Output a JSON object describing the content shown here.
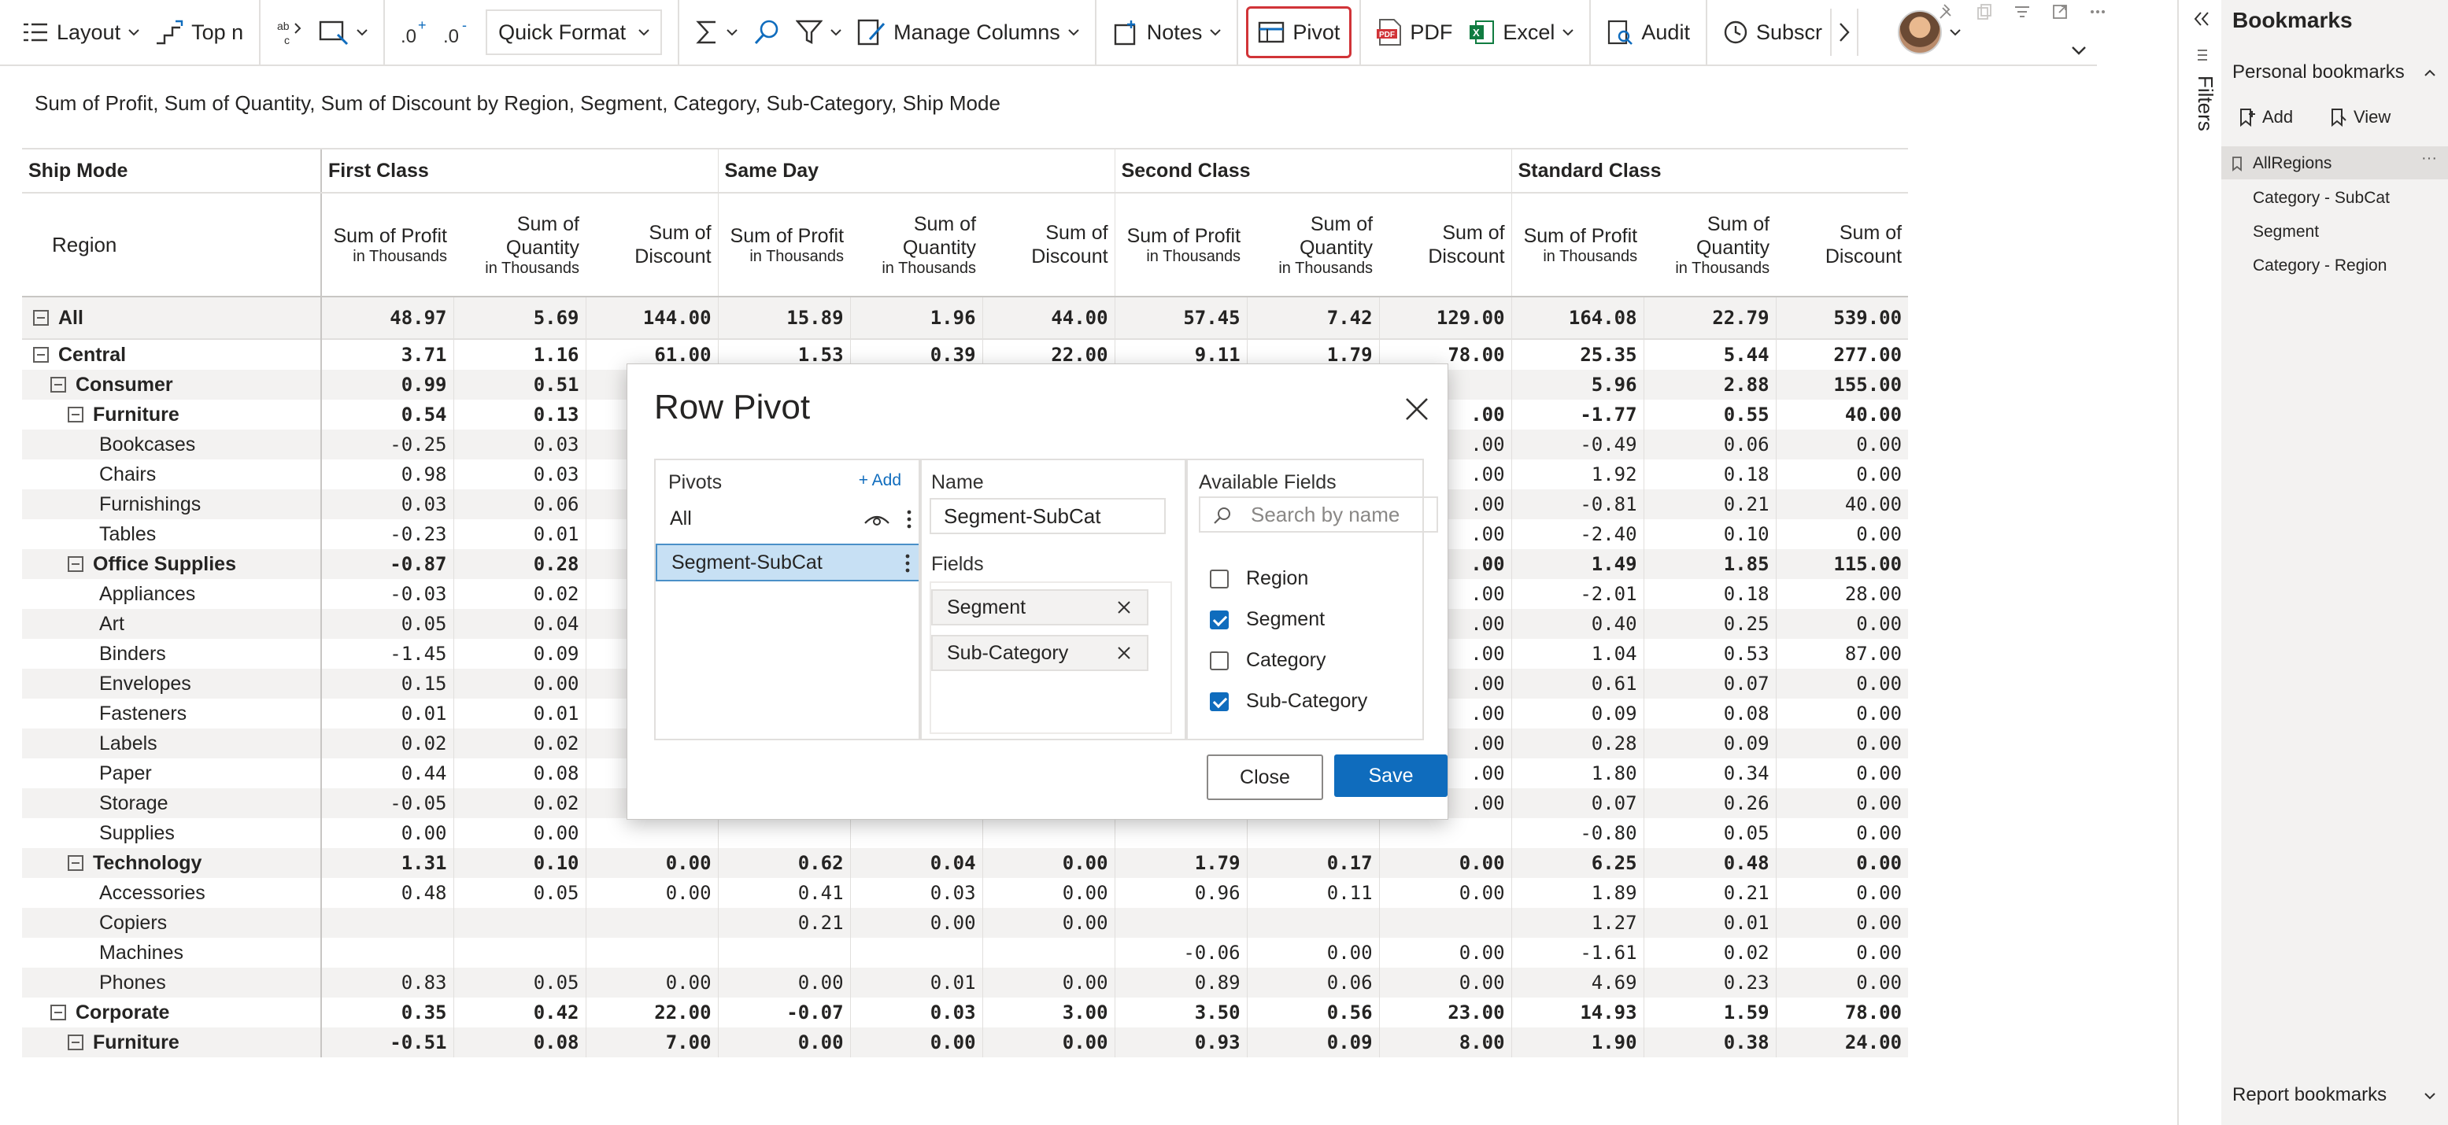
{
  "toolbar": {
    "layout": "Layout",
    "top_n": "Top n",
    "quick_format": "Quick Format",
    "manage_columns": "Manage Columns",
    "notes": "Notes",
    "pivot": "Pivot",
    "pdf": "PDF",
    "excel": "Excel",
    "audit": "Audit",
    "subscribe": "Subscr"
  },
  "report": {
    "title": "Sum of Profit, Sum of Quantity, Sum of Discount by Region, Segment, Category, Sub-Category, Ship Mode"
  },
  "table": {
    "col_group_label": "Ship Mode",
    "row_label": "Region",
    "ship_modes": [
      "First Class",
      "Same Day",
      "Second Class",
      "Standard Class"
    ],
    "measures": {
      "profit": "Sum of Profit",
      "quantity_1": "Sum of",
      "quantity_2": "Quantity",
      "discount_1": "Sum of",
      "discount_2": "Discount",
      "unit": "in Thousands"
    },
    "rows": [
      {
        "label": "All",
        "v": [
          "48.97",
          "5.69",
          "144.00",
          "15.89",
          "1.96",
          "44.00",
          "57.45",
          "7.42",
          "129.00",
          "164.08",
          "22.79",
          "539.00"
        ]
      },
      {
        "label": "Central",
        "v": [
          "3.71",
          "1.16",
          "61.00",
          "1.53",
          "0.39",
          "22.00",
          "9.11",
          "1.79",
          "78.00",
          "25.35",
          "5.44",
          "277.00"
        ]
      },
      {
        "label": "Consumer",
        "v": [
          "0.99",
          "0.51",
          "",
          "",
          "",
          "",
          "",
          "",
          "",
          "5.96",
          "2.88",
          "155.00"
        ]
      },
      {
        "label": "Furniture",
        "v": [
          "0.54",
          "0.13",
          "",
          "",
          "",
          "",
          "",
          "",
          ".00",
          "-1.77",
          "0.55",
          "40.00"
        ]
      },
      {
        "label": "Bookcases",
        "v": [
          "-0.25",
          "0.03",
          "",
          "",
          "",
          "",
          "",
          "",
          ".00",
          "-0.49",
          "0.06",
          "0.00"
        ]
      },
      {
        "label": "Chairs",
        "v": [
          "0.98",
          "0.03",
          "",
          "",
          "",
          "",
          "",
          "",
          ".00",
          "1.92",
          "0.18",
          "0.00"
        ]
      },
      {
        "label": "Furnishings",
        "v": [
          "0.03",
          "0.06",
          "",
          "",
          "",
          "",
          "",
          "",
          ".00",
          "-0.81",
          "0.21",
          "40.00"
        ]
      },
      {
        "label": "Tables",
        "v": [
          "-0.23",
          "0.01",
          "",
          "",
          "",
          "",
          "",
          "",
          ".00",
          "-2.40",
          "0.10",
          "0.00"
        ]
      },
      {
        "label": "Office Supplies",
        "v": [
          "-0.87",
          "0.28",
          "",
          "",
          "",
          "",
          "",
          "",
          ".00",
          "1.49",
          "1.85",
          "115.00"
        ]
      },
      {
        "label": "Appliances",
        "v": [
          "-0.03",
          "0.02",
          "",
          "",
          "",
          "",
          "",
          "",
          ".00",
          "-2.01",
          "0.18",
          "28.00"
        ]
      },
      {
        "label": "Art",
        "v": [
          "0.05",
          "0.04",
          "",
          "",
          "",
          "",
          "",
          "",
          ".00",
          "0.40",
          "0.25",
          "0.00"
        ]
      },
      {
        "label": "Binders",
        "v": [
          "-1.45",
          "0.09",
          "",
          "",
          "",
          "",
          "",
          "",
          ".00",
          "1.04",
          "0.53",
          "87.00"
        ]
      },
      {
        "label": "Envelopes",
        "v": [
          "0.15",
          "0.00",
          "",
          "",
          "",
          "",
          "",
          "",
          ".00",
          "0.61",
          "0.07",
          "0.00"
        ]
      },
      {
        "label": "Fasteners",
        "v": [
          "0.01",
          "0.01",
          "",
          "",
          "",
          "",
          "",
          "",
          ".00",
          "0.09",
          "0.08",
          "0.00"
        ]
      },
      {
        "label": "Labels",
        "v": [
          "0.02",
          "0.02",
          "",
          "",
          "",
          "",
          "",
          "",
          ".00",
          "0.28",
          "0.09",
          "0.00"
        ]
      },
      {
        "label": "Paper",
        "v": [
          "0.44",
          "0.08",
          "",
          "",
          "",
          "",
          "",
          "",
          ".00",
          "1.80",
          "0.34",
          "0.00"
        ]
      },
      {
        "label": "Storage",
        "v": [
          "-0.05",
          "0.02",
          "",
          "",
          "",
          "",
          "",
          "",
          ".00",
          "0.07",
          "0.26",
          "0.00"
        ]
      },
      {
        "label": "Supplies",
        "v": [
          "0.00",
          "0.00",
          "",
          "",
          "",
          "",
          "",
          "",
          "",
          "-0.80",
          "0.05",
          "0.00"
        ]
      },
      {
        "label": "Technology",
        "v": [
          "1.31",
          "0.10",
          "0.00",
          "0.62",
          "0.04",
          "0.00",
          "1.79",
          "0.17",
          "0.00",
          "6.25",
          "0.48",
          "0.00"
        ]
      },
      {
        "label": "Accessories",
        "v": [
          "0.48",
          "0.05",
          "0.00",
          "0.41",
          "0.03",
          "0.00",
          "0.96",
          "0.11",
          "0.00",
          "1.89",
          "0.21",
          "0.00"
        ]
      },
      {
        "label": "Copiers",
        "v": [
          "",
          "",
          "",
          "0.21",
          "0.00",
          "0.00",
          "",
          "",
          "",
          "1.27",
          "0.01",
          "0.00"
        ]
      },
      {
        "label": "Machines",
        "v": [
          "",
          "",
          "",
          "",
          "",
          "",
          "-0.06",
          "0.00",
          "0.00",
          "-1.61",
          "0.02",
          "0.00"
        ]
      },
      {
        "label": "Phones",
        "v": [
          "0.83",
          "0.05",
          "0.00",
          "0.00",
          "0.01",
          "0.00",
          "0.89",
          "0.06",
          "0.00",
          "4.69",
          "0.23",
          "0.00"
        ]
      },
      {
        "label": "Corporate",
        "v": [
          "0.35",
          "0.42",
          "22.00",
          "-0.07",
          "0.03",
          "3.00",
          "3.50",
          "0.56",
          "23.00",
          "14.93",
          "1.59",
          "78.00"
        ]
      },
      {
        "label": "Furniture",
        "v": [
          "-0.51",
          "0.08",
          "7.00",
          "0.00",
          "0.00",
          "0.00",
          "0.93",
          "0.09",
          "8.00",
          "1.90",
          "0.38",
          "24.00"
        ]
      }
    ]
  },
  "modal": {
    "title": "Row Pivot",
    "pivots_header": "Pivots",
    "add_label": "+ Add",
    "pivot_all": "All",
    "pivot_selected": "Segment-SubCat",
    "name_header": "Name",
    "name_value": "Segment-SubCat",
    "fields_header": "Fields",
    "field_1": "Segment",
    "field_2": "Sub-Category",
    "available_header": "Available Fields",
    "search_placeholder": "Search by name",
    "avail": [
      {
        "label": "Region",
        "checked": false
      },
      {
        "label": "Segment",
        "checked": true
      },
      {
        "label": "Category",
        "checked": false
      },
      {
        "label": "Sub-Category",
        "checked": true
      }
    ],
    "close_label": "Close",
    "save_label": "Save"
  },
  "filters": {
    "label": "Filters"
  },
  "bookmarks": {
    "title": "Bookmarks",
    "personal": "Personal bookmarks",
    "add": "Add",
    "view": "View",
    "items": [
      "AllRegions",
      "Category - SubCat",
      "Segment",
      "Category - Region"
    ],
    "report": "Report bookmarks"
  },
  "colors": {
    "accent": "#0f6cbd",
    "active_outline": "#d13438",
    "selected_pivot": "#c7e0f4"
  }
}
